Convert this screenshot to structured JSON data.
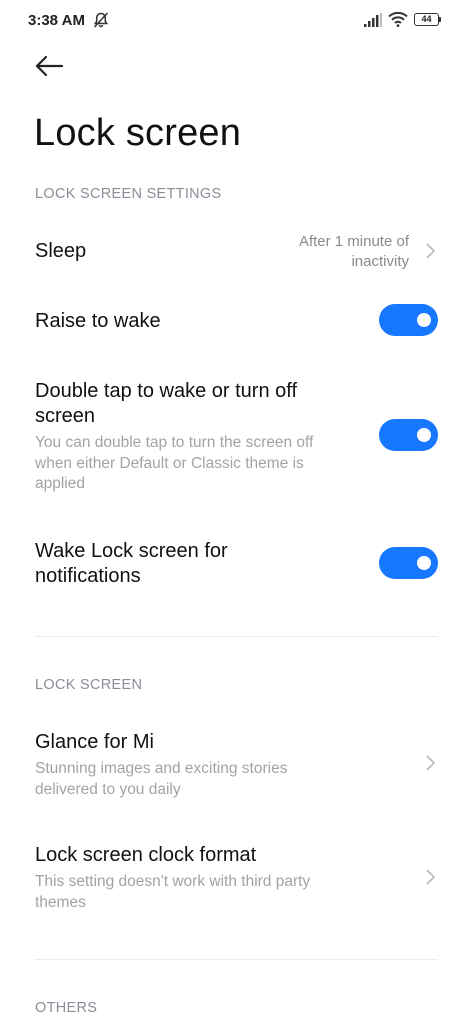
{
  "status_bar": {
    "time": "3:38 AM",
    "battery": "44",
    "icons": [
      "mute-off-icon",
      "signal-icon",
      "wifi-icon",
      "battery-icon"
    ]
  },
  "header": {
    "back_icon": "back-arrow-icon",
    "title": "Lock screen"
  },
  "sections": {
    "lock_screen_settings": "LOCK SCREEN SETTINGS",
    "lock_screen": "LOCK SCREEN",
    "others": "OTHERS"
  },
  "items": {
    "sleep": {
      "title": "Sleep",
      "value_line1": "After 1 minute of",
      "value_line2": "inactivity"
    },
    "raise_to_wake": {
      "title": "Raise to wake",
      "enabled": true
    },
    "double_tap": {
      "title_line1": "Double tap to wake or turn off",
      "title_line2": "screen",
      "desc_line1": "You can double tap to turn the screen off",
      "desc_line2": "when either Default or Classic theme is",
      "desc_line3": "applied",
      "enabled": true
    },
    "wake_notifications": {
      "title_line1": "Wake Lock screen for",
      "title_line2": "notifications",
      "enabled": true
    },
    "glance": {
      "title": "Glance for Mi",
      "desc_line1": "Stunning images and exciting stories",
      "desc_line2": "delivered to you daily"
    },
    "clock_format": {
      "title": "Lock screen clock format",
      "desc_line1": "This setting doesn't work with third party",
      "desc_line2": "themes"
    }
  },
  "colors": {
    "accent": "#1677ff",
    "section_header": "#8c8c99",
    "description": "#a3a3a3"
  }
}
